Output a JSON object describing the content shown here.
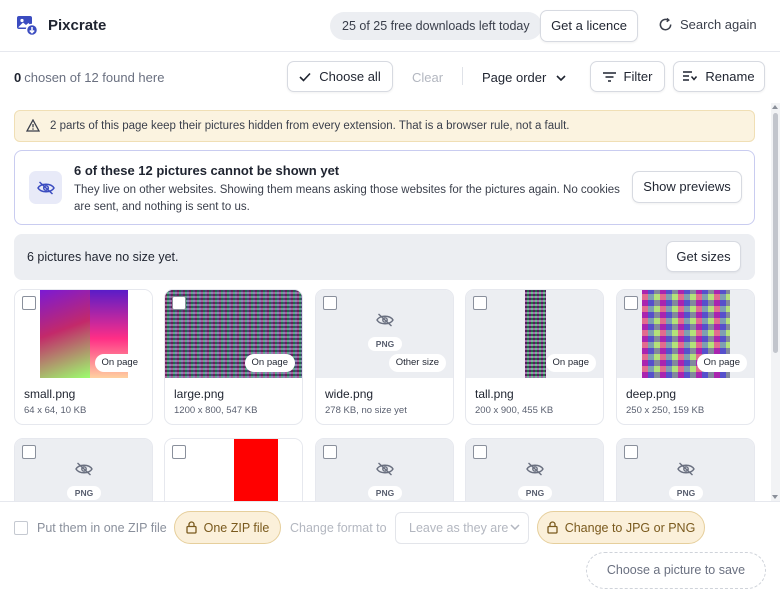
{
  "app": {
    "name": "Pixcrate",
    "quota": "25 of 25 free downloads left today",
    "licence_label": "Get a licence",
    "search_again_label": "Search again"
  },
  "toolbar": {
    "chosen_count": "0",
    "chosen_text": "chosen of 12 found here",
    "choose_all_label": "Choose all",
    "clear_label": "Clear",
    "order_label": "Page order",
    "filter_label": "Filter",
    "rename_label": "Rename"
  },
  "notices": {
    "warning": "2 parts of this page keep their pictures hidden from every extension. That is a browser rule, not a fault.",
    "blocked_title": "6 of these 12 pictures cannot be shown yet",
    "blocked_desc": "They live on other websites. Showing them means asking those websites for the pictures again. No cookies are sent, and nothing is sent to us.",
    "show_previews_label": "Show previews",
    "no_size_text": "6 pictures have no size yet.",
    "get_sizes_label": "Get sizes"
  },
  "cards": [
    {
      "name": "small.png",
      "meta": "64 x 64, 10 KB",
      "badge": "On page",
      "kind": "small"
    },
    {
      "name": "large.png",
      "meta": "1200 x 800, 547 KB",
      "badge": "On page",
      "kind": "large"
    },
    {
      "name": "wide.png",
      "meta": "278 KB, no size yet",
      "badge": "Other size",
      "kind": "hidden",
      "tag": "PNG"
    },
    {
      "name": "tall.png",
      "meta": "200 x 900, 455 KB",
      "badge": "On page",
      "kind": "tall"
    },
    {
      "name": "deep.png",
      "meta": "250 x 250, 159 KB",
      "badge": "On page",
      "kind": "deep"
    },
    {
      "kind": "hidden",
      "tag": "PNG"
    },
    {
      "kind": "flag"
    },
    {
      "kind": "hidden",
      "tag": "PNG"
    },
    {
      "kind": "hidden",
      "tag": "PNG"
    },
    {
      "kind": "hidden",
      "tag": "PNG"
    }
  ],
  "bottom": {
    "zip_label": "Put them in one ZIP file",
    "one_zip_label": "One ZIP file",
    "change_format_label": "Change format to",
    "format_value": "Leave as they are",
    "to_jpg_label": "Change to JPG or PNG",
    "save_label": "Choose a picture to save"
  },
  "colors": {
    "accent_amber": "#fbf0da",
    "warning_bg": "#fbf3e0",
    "blocked_border": "#c9ccf0",
    "flag_red": "#ff0000"
  }
}
